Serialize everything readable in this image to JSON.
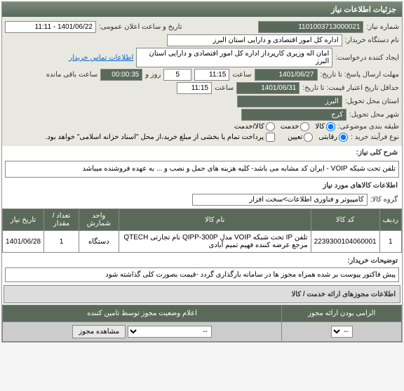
{
  "panel_title": "جزئیات اطلاعات نیاز",
  "header": {
    "need_no_label": "شماره نیاز:",
    "need_no": "1101003713000021",
    "public_announce_label": "تاریخ و ساعت اعلان عمومی:",
    "public_announce": "1401/06/22 - 11:11",
    "buyer_org_label": "نام دستگاه خریدار:",
    "buyer_org": "اداره کل امور اقتصادی و دارایی استان البرز",
    "requester_label": "ایجاد کننده درخواست:",
    "requester": "امان اله وزیری کارپرداز اداره کل امور اقتصادی و دارایی استان البرز",
    "contact_link": "اطلاعات تماس خریدار",
    "deadline_label": "مهلت ارسال پاسخ: تا تاریخ:",
    "deadline_date": "1401/06/27",
    "time_label": "ساعت",
    "deadline_time": "11:15",
    "days_label": "روز و",
    "days": "5",
    "remain_time": "00:00:35",
    "remain_label": "ساعت باقی مانده",
    "validity_label": "حداقل تاریخ اعتبار قیمت: تا تاریخ:",
    "validity_date": "1401/06/31",
    "validity_time": "11:15",
    "province_label": "استان محل تحویل:",
    "province": "البرز",
    "city_label": "شهر محل تحویل:",
    "city": "کرج",
    "classify_label": "طبقه بندی موضوعی:",
    "c1": "کالا",
    "c2": "خدمت",
    "c3": "کالا/خدمت",
    "process_label": "نوع فرآیند خرید :",
    "p1": "رقابتی",
    "p2": "تعیین",
    "payment_label": "پرداخت تمام یا بخشی از مبلغ خرید،از محل \"اسناد خزانه اسلامی\" خواهد بود."
  },
  "desc": {
    "title_label": "شرح کلی نیاز:",
    "title_text": "تلفن تحت شبکه VOIP - ایران کد مشابه می باشد- کلیه هزینه های حمل و نصب و ... به عهده فروشنده میباشد",
    "group_label": "گروه کالا:",
    "group_text": "کامپیوتر و فناوری اطلاعات>سخت افزار",
    "items_title": "اطلاعات کالاهای مورد نیاز"
  },
  "table": {
    "h_row": "ردیف",
    "h_code": "کد کالا",
    "h_name": "نام کالا",
    "h_unit": "واحد شمارش",
    "h_qty": "تعداد / مقدار",
    "h_date": "تاریخ نیاز",
    "r1_row": "1",
    "r1_code": "2239300104060001",
    "r1_name": "تلفن IP تحت شبکه VOIP مدل QIPP-300P نام تجارتی QTECH مرجع عرضه کننده فهیم تمیم آبادی",
    "r1_unit": "دستگاه",
    "r1_qty": "1",
    "r1_date": "1401/06/28"
  },
  "notes": {
    "label": "توضیحات خریدار:",
    "text": "پیش فاکتور پیوست بر شده همراه مجوز ها در سامانه بارگذاری گردد -قیمت بصورت کلی گذاشته شود"
  },
  "footer_title": "اطلاعات مجوزهای ارائه خدمت / کالا",
  "lower": {
    "h1": "الزامی بودن ارائه مجوز",
    "h2": "اعلام وضعیت مجوز توسط تامین کننده",
    "sel_empty": "--",
    "btn": "مشاهده مجوز"
  }
}
